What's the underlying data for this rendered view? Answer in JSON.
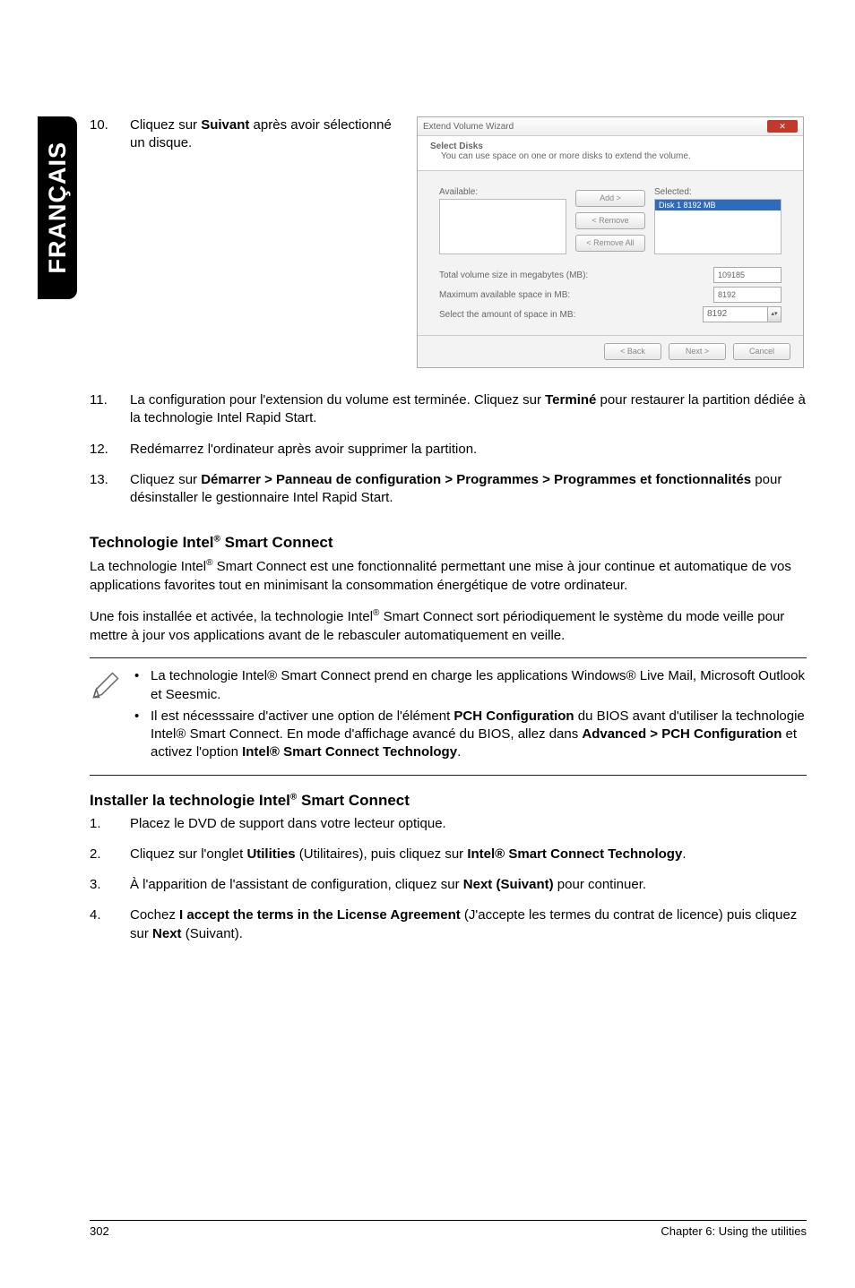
{
  "lang_tab": "FRANÇAIS",
  "steps_a": [
    {
      "n": "10.",
      "html": "Cliquez sur <b data-bind=\"kw.suivant\"></b> après avoir sélectionné un disque."
    },
    {
      "n": "11.",
      "html": "La configuration pour l'extension du volume est terminée. Cliquez sur <b data-bind=\"kw.termine\"></b> pour restaurer la partition dédiée à la technologie Intel Rapid Start."
    },
    {
      "n": "12.",
      "html": "Redémarrez l'ordinateur après avoir supprimer la partition."
    },
    {
      "n": "13.",
      "html": "Cliquez sur <b data-bind=\"kw.path1\"></b> pour désinstaller le gestionnaire Intel Rapid Start."
    }
  ],
  "kw": {
    "suivant": "Suivant",
    "termine": "Terminé",
    "path1": "Démarrer > Panneau de configuration > Programmes > Programmes et fonctionnalités",
    "pch": "PCH Configuration",
    "advpch": "Advanced > PCH Configuration",
    "isct": "Intel® Smart Connect Technology",
    "util": "Utilities",
    "isctn": "Intel® Smart Connect Technology",
    "next": "Next (Suivant)",
    "accept": "I accept the terms in the License Agreement",
    "next2": "Next"
  },
  "heading1": "Technologie Intel® Smart Connect",
  "para1": "La technologie Intel® Smart Connect est une fonctionnalité permettant une mise à jour continue et automatique de vos applications favorites tout en minimisant la consommation énergétique de votre ordinateur.",
  "para2": "Une fois installée et activée, la technologie Intel® Smart Connect sort périodiquement le système du mode veille pour mettre à jour vos applications avant de  le rebasculer automatiquement en veille.",
  "note": [
    "La technologie Intel® Smart Connect prend en charge les applications Windows® Live Mail, Microsoft Outlook et Seesmic.",
    "Il est nécesssaire d'activer une option de l'élément <b data-bind=\"kw.pch\"></b> du BIOS avant d'utiliser la technologie Intel® Smart Connect. En mode d'affichage avancé du BIOS, allez dans <b data-bind=\"kw.advpch\"></b> et activez l'option <b data-bind=\"kw.isct\"></b>."
  ],
  "heading2": "Installer la technologie Intel® Smart Connect",
  "steps_b": [
    {
      "n": "1.",
      "html": "Placez le DVD de support dans votre lecteur optique."
    },
    {
      "n": "2.",
      "html": "Cliquez sur l'onglet <b data-bind=\"kw.util\"></b> (Utilitaires), puis cliquez sur <b data-bind=\"kw.isctn\"></b>."
    },
    {
      "n": "3.",
      "html": "À l'apparition de l'assistant de configuration, cliquez sur <b data-bind=\"kw.next\"></b> pour continuer."
    },
    {
      "n": "4.",
      "html": "Cochez <b data-bind=\"kw.accept\"></b> (J'accepte les termes du contrat de licence) puis cliquez sur <b data-bind=\"kw.next2\"></b> (Suivant)."
    }
  ],
  "wizard": {
    "title": "Extend Volume Wizard",
    "head": "Select Disks",
    "sub": "You can use space on one or more disks to extend the volume.",
    "available": "Available:",
    "selected": "Selected:",
    "selrow": "Disk 1    8192 MB",
    "btn_add": "Add >",
    "btn_rem": "< Remove",
    "btn_remall": "< Remove All",
    "row1": "Total volume size in megabytes (MB):",
    "row1v": "109185",
    "row2": "Maximum available space in MB:",
    "row2v": "8192",
    "row3": "Select the amount of space in MB:",
    "row3v": "8192",
    "back": "< Back",
    "nextb": "Next >",
    "cancel": "Cancel"
  },
  "footer": {
    "page": "302",
    "chap": "Chapter 6: Using the utilities"
  }
}
